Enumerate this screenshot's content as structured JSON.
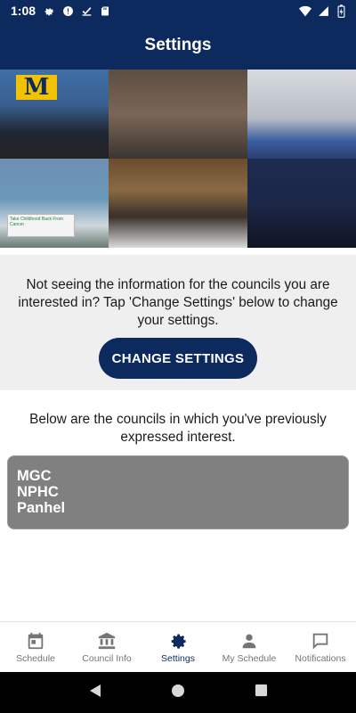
{
  "status_bar": {
    "time": "1:08",
    "left_icons": [
      "gear-icon",
      "alert-icon",
      "download-done-icon",
      "sd-card-icon"
    ],
    "right_icons": [
      "wifi-icon",
      "signal-icon",
      "battery-charging-icon"
    ]
  },
  "app_bar": {
    "title": "Settings"
  },
  "collage": {
    "banner_letter": "M",
    "sign_text": "Take Childhood Back From Cancer"
  },
  "info": {
    "message": "Not seeing the information for the councils you are interested in? Tap 'Change Settings' below to change your settings.",
    "button_label": "CHANGE SETTINGS"
  },
  "councils_intro": "Below are the councils in which you've previously expressed interest.",
  "councils": [
    "MGC",
    "NPHC",
    "Panhel"
  ],
  "bottom_nav": {
    "items": [
      {
        "label": "Schedule",
        "icon": "calendar-icon",
        "active": false
      },
      {
        "label": "Council Info",
        "icon": "institution-icon",
        "active": false
      },
      {
        "label": "Settings",
        "icon": "gear-icon",
        "active": true
      },
      {
        "label": "My Schedule",
        "icon": "person-icon",
        "active": false
      },
      {
        "label": "Notifications",
        "icon": "chat-bubble-icon",
        "active": false
      }
    ]
  },
  "system_nav": [
    "back-icon",
    "home-icon",
    "recents-icon"
  ],
  "colors": {
    "primary": "#0d2a5e",
    "card": "#808080",
    "info_bg": "#efefef"
  }
}
